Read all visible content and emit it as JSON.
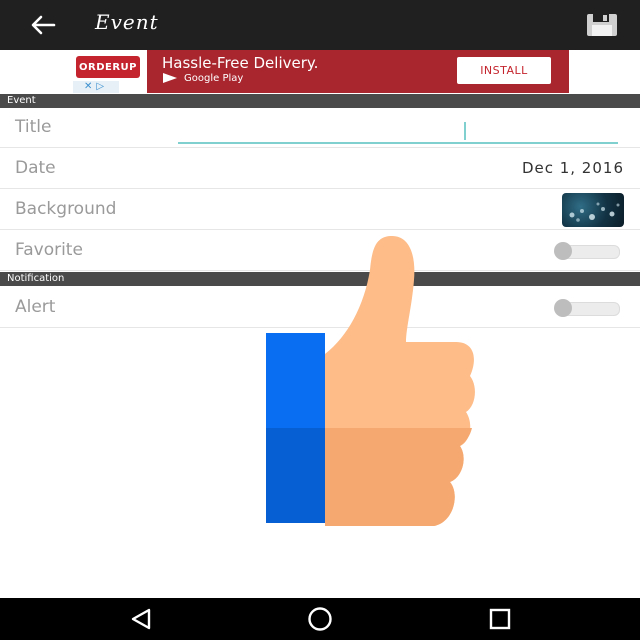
{
  "app_bar": {
    "title": "Event",
    "icons": {
      "back": "arrow-left-icon",
      "save": "floppy-disk-icon"
    },
    "background": "#202020"
  },
  "ad": {
    "logo": "ORDERUP",
    "headline": "Hassle-Free Delivery.",
    "store": "Google Play",
    "cta": "INSTALL",
    "background": "#a9262f"
  },
  "sections": {
    "event": "Event",
    "notification": "Notification"
  },
  "rows": {
    "title": {
      "label": "Title",
      "value": ""
    },
    "date": {
      "label": "Date",
      "value": "Dec 1, 2016"
    },
    "background": {
      "label": "Background"
    },
    "favorite": {
      "label": "Favorite",
      "on": false
    },
    "alert": {
      "label": "Alert",
      "on": false
    }
  },
  "overlay": {
    "icon": "thumbs-up-icon"
  },
  "nav_bar": {
    "icons": [
      "back-triangle-icon",
      "home-circle-icon",
      "recents-square-icon"
    ]
  },
  "colors": {
    "accent": "#7fd0cf",
    "section_header": "#4a4a4a"
  }
}
